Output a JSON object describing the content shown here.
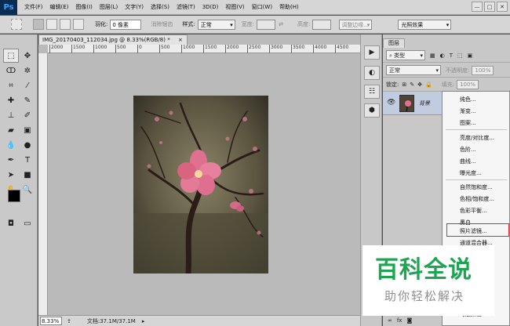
{
  "app": {
    "logo": "Ps"
  },
  "menu": [
    "文件(F)",
    "编辑(E)",
    "图像(I)",
    "图层(L)",
    "文字(Y)",
    "选择(S)",
    "滤镜(T)",
    "3D(D)",
    "视图(V)",
    "窗口(W)",
    "帮助(H)"
  ],
  "window_buttons": [
    "—",
    "□",
    "✕"
  ],
  "options": {
    "feather_label": "羽化:",
    "feather_value": "0 像素",
    "antialias_label": "消除锯齿",
    "style_label": "样式:",
    "style_value": "正常",
    "width_label": "宽度:",
    "height_label": "高度:",
    "refine_edge": "调整边缘...",
    "workspace": "光照效果"
  },
  "document": {
    "tab_title": "IMG_20170403_112034.jpg @ 8.33%(RGB/8) *",
    "tab_close": "×",
    "ruler_ticks": [
      "2000",
      "1500",
      "1000",
      "500",
      "0",
      "500",
      "1000",
      "1500",
      "2000",
      "2500",
      "3000",
      "3500",
      "4000",
      "4500"
    ],
    "zoom": "8.33%",
    "doc_size": "文档:37.1M/37.1M"
  },
  "layers": {
    "tab_label": "图层",
    "filter_kind": "类型",
    "blend_mode": "正常",
    "opacity_label": "不透明度:",
    "opacity_value": "100%",
    "lock_label": "锁定:",
    "fill_label": "填充:",
    "fill_value": "100%",
    "background_layer_name": "背景"
  },
  "adjustment_menu": {
    "group1": [
      "纯色...",
      "渐变...",
      "图案..."
    ],
    "group2": [
      "亮度/对比度...",
      "色阶...",
      "曲线...",
      "曝光度..."
    ],
    "group3": [
      "自然饱和度...",
      "色相/饱和度...",
      "色彩平衡...",
      "黑白...",
      "照片滤镜...",
      "通道混合器..."
    ],
    "bottom": "可选颜色...",
    "highlighted": "照片滤镜...",
    "highlight_color": "#d63030"
  },
  "watermark": {
    "title": "百科全说",
    "subtitle": "助你轻松解决",
    "title_color": "#1ea552"
  }
}
